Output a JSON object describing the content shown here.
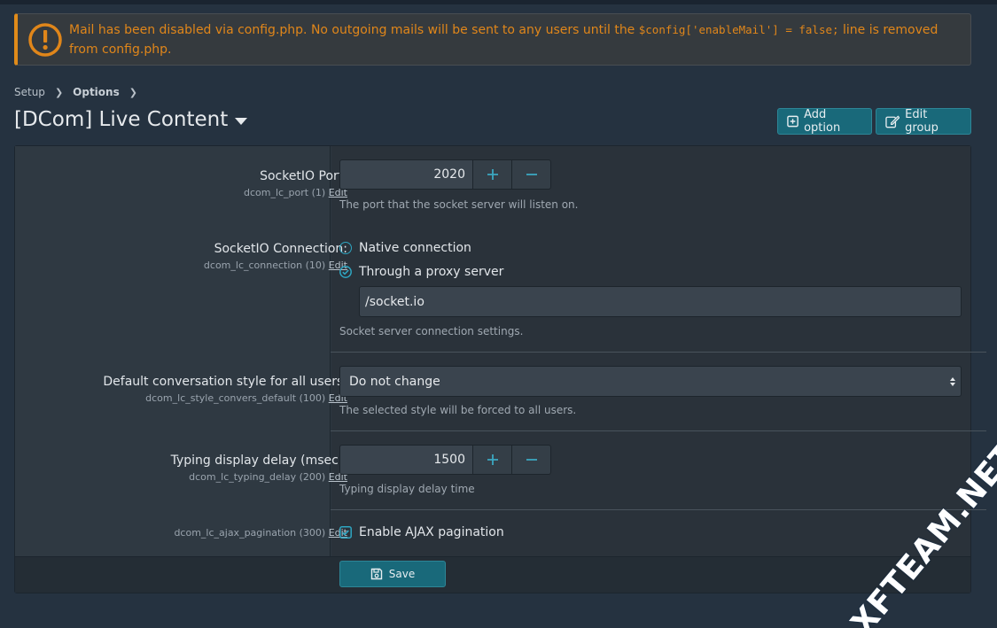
{
  "notice": {
    "text_before": "Mail has been disabled via config.php. No outgoing mails will be sent to any users until the ",
    "code": "$config['enableMail'] = false;",
    "text_after": " line is removed from config.php."
  },
  "breadcrumb": [
    {
      "label": "Setup"
    },
    {
      "label": "Options"
    }
  ],
  "page_title": "[DCom] Live Content",
  "actions": {
    "add_option": "Add option",
    "edit_group": "Edit group"
  },
  "options": {
    "port": {
      "label": "SocketIO Port:",
      "key": "dcom_lc_port (1)",
      "edit": "Edit",
      "value": "2020",
      "explain": "The port that the socket server will listen on."
    },
    "connection": {
      "label": "SocketIO Connection:",
      "key": "dcom_lc_connection (10)",
      "edit": "Edit",
      "choice_native": "Native connection",
      "choice_proxy": "Through a proxy server",
      "proxy_path": "/socket.io",
      "explain": "Socket server connection settings."
    },
    "style": {
      "label": "Default conversation style for all users:",
      "key": "dcom_lc_style_convers_default (100)",
      "edit": "Edit",
      "selected": "Do not change",
      "explain": "The selected style will be forced to all users."
    },
    "typing": {
      "label": "Typing display delay (msec):",
      "key": "dcom_lc_typing_delay (200)",
      "edit": "Edit",
      "value": "1500",
      "explain": "Typing display delay time"
    },
    "ajax": {
      "key": "dcom_lc_ajax_pagination (300)",
      "edit": "Edit",
      "checkbox_label": "Enable AJAX pagination"
    }
  },
  "save_label": "Save",
  "watermark": "XFTEAM.NET",
  "colors": {
    "accent": "#19697a",
    "warning": "#e0861a",
    "background": "#253240"
  }
}
